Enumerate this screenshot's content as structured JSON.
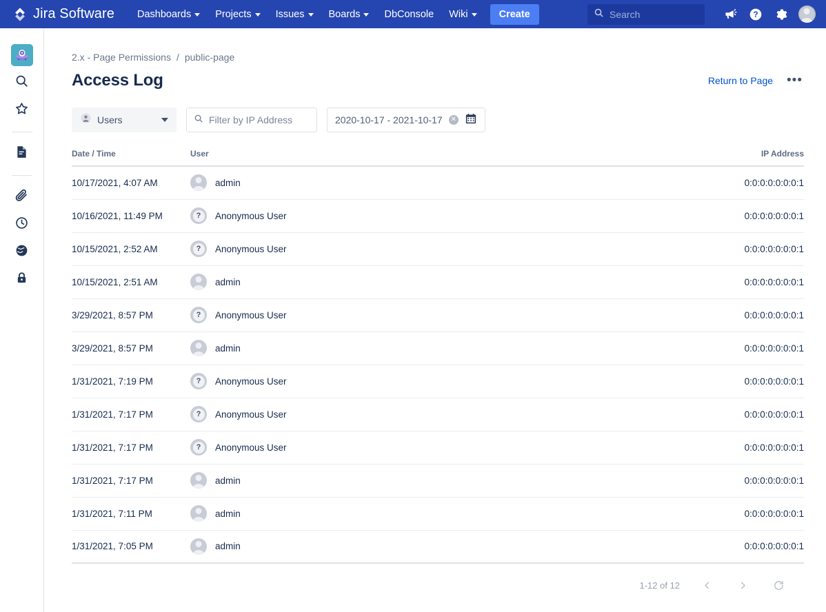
{
  "topnav": {
    "brand": "Jira Software",
    "brand_logo_icon": "jira-diamond-logo",
    "items": [
      {
        "label": "Dashboards",
        "has_dropdown": true
      },
      {
        "label": "Projects",
        "has_dropdown": true
      },
      {
        "label": "Issues",
        "has_dropdown": true
      },
      {
        "label": "Boards",
        "has_dropdown": true
      },
      {
        "label": "DbConsole",
        "has_dropdown": false
      },
      {
        "label": "Wiki",
        "has_dropdown": true
      }
    ],
    "create_label": "Create",
    "search_placeholder": "Search",
    "search_value": "",
    "icons": [
      "search-icon",
      "megaphone-icon",
      "help-icon",
      "settings-gear-icon",
      "user-avatar"
    ],
    "background_color": "#2546b0",
    "create_color": "#4c7ef3"
  },
  "rail": {
    "project_avatar_icon": "ufo-project-avatar",
    "items": [
      {
        "icon": "project-avatar",
        "name": "project-avatar"
      },
      {
        "icon": "search-icon",
        "name": "rail-search"
      },
      {
        "icon": "star-icon",
        "name": "rail-starred"
      },
      {
        "icon": "page-document-icon",
        "name": "rail-pages"
      },
      {
        "icon": "paperclip-icon",
        "name": "rail-attachments"
      },
      {
        "icon": "clock-icon",
        "name": "rail-history"
      },
      {
        "icon": "globe-icon",
        "name": "rail-global"
      },
      {
        "icon": "lock-icon",
        "name": "rail-permissions"
      }
    ]
  },
  "breadcrumb": {
    "items": [
      "2.x - Page Permissions",
      "public-page"
    ],
    "separator": "/"
  },
  "header": {
    "title": "Access Log",
    "return_label": "Return to Page",
    "more_label": "•••"
  },
  "filters": {
    "user_select": {
      "label": "Users",
      "icon": "person-icon",
      "chevron": "chevron-down-icon"
    },
    "ip_filter": {
      "placeholder": "Filter by IP Address",
      "value": "",
      "icon": "search-icon"
    },
    "date_range": {
      "value": "2020-10-17 - 2021-10-17",
      "clear_icon": "clear-circle-icon",
      "calendar_icon": "calendar-icon"
    }
  },
  "table": {
    "columns": [
      "Date / Time",
      "User",
      "IP Address"
    ],
    "rows": [
      {
        "datetime": "10/17/2021, 4:07 AM",
        "user": "admin",
        "avatar": "person",
        "ip": "0:0:0:0:0:0:0:1"
      },
      {
        "datetime": "10/16/2021, 11:49 PM",
        "user": "Anonymous User",
        "avatar": "anon",
        "ip": "0:0:0:0:0:0:0:1"
      },
      {
        "datetime": "10/15/2021, 2:52 AM",
        "user": "Anonymous User",
        "avatar": "anon",
        "ip": "0:0:0:0:0:0:0:1"
      },
      {
        "datetime": "10/15/2021, 2:51 AM",
        "user": "admin",
        "avatar": "person",
        "ip": "0:0:0:0:0:0:0:1"
      },
      {
        "datetime": "3/29/2021, 8:57 PM",
        "user": "Anonymous User",
        "avatar": "anon",
        "ip": "0:0:0:0:0:0:0:1"
      },
      {
        "datetime": "3/29/2021, 8:57 PM",
        "user": "admin",
        "avatar": "person",
        "ip": "0:0:0:0:0:0:0:1"
      },
      {
        "datetime": "1/31/2021, 7:19 PM",
        "user": "Anonymous User",
        "avatar": "anon",
        "ip": "0:0:0:0:0:0:0:1"
      },
      {
        "datetime": "1/31/2021, 7:17 PM",
        "user": "Anonymous User",
        "avatar": "anon",
        "ip": "0:0:0:0:0:0:0:1"
      },
      {
        "datetime": "1/31/2021, 7:17 PM",
        "user": "Anonymous User",
        "avatar": "anon",
        "ip": "0:0:0:0:0:0:0:1"
      },
      {
        "datetime": "1/31/2021, 7:17 PM",
        "user": "admin",
        "avatar": "person",
        "ip": "0:0:0:0:0:0:0:1"
      },
      {
        "datetime": "1/31/2021, 7:11 PM",
        "user": "admin",
        "avatar": "person",
        "ip": "0:0:0:0:0:0:0:1"
      },
      {
        "datetime": "1/31/2021, 7:05 PM",
        "user": "admin",
        "avatar": "person",
        "ip": "0:0:0:0:0:0:0:1"
      }
    ]
  },
  "pagination": {
    "count_label": "1-12 of 12",
    "prev_icon": "chevron-left-icon",
    "next_icon": "chevron-right-icon",
    "refresh_icon": "refresh-icon"
  }
}
